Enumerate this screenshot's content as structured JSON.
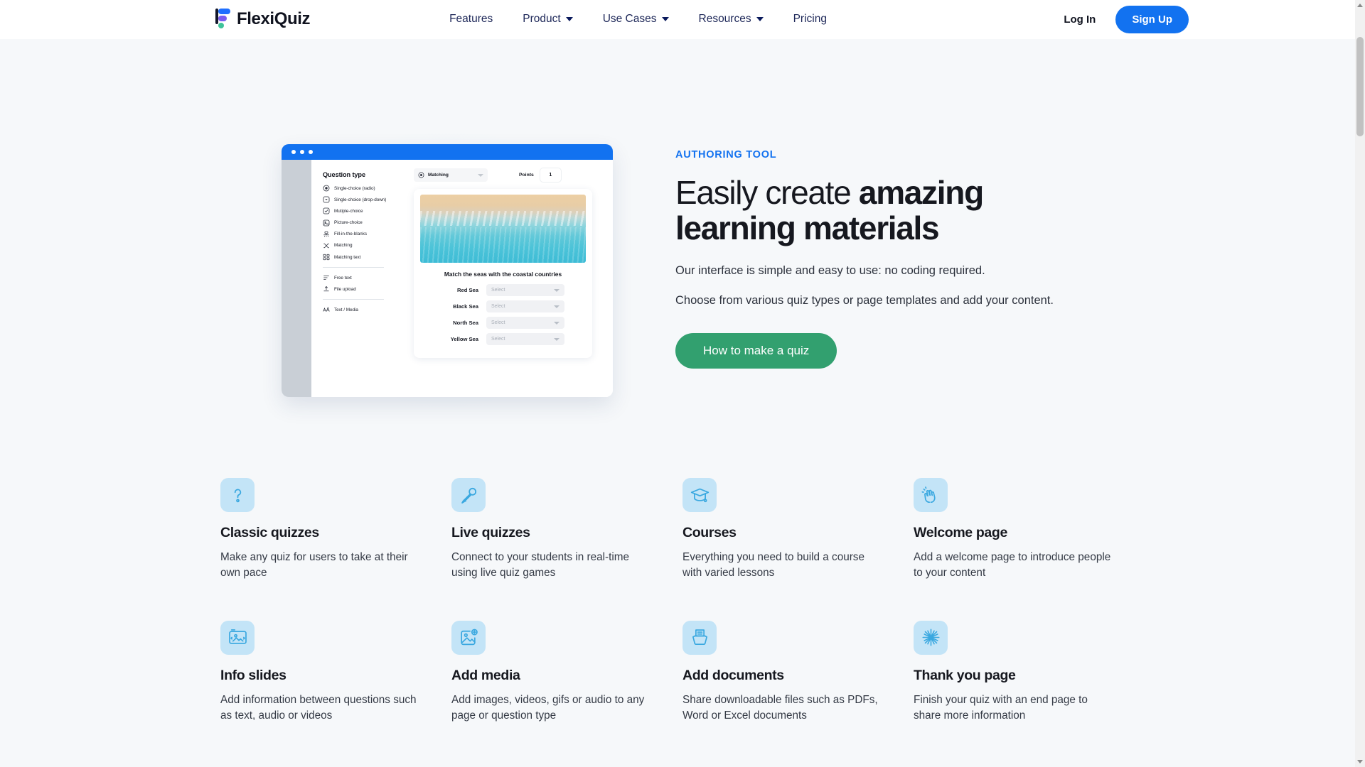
{
  "nav": {
    "logo_text": "FlexiQuiz",
    "links": [
      {
        "label": "Features",
        "has_caret": false
      },
      {
        "label": "Product",
        "has_caret": true
      },
      {
        "label": "Use Cases",
        "has_caret": true
      },
      {
        "label": "Resources",
        "has_caret": true
      },
      {
        "label": "Pricing",
        "has_caret": false
      }
    ],
    "login_label": "Log In",
    "signup_label": "Sign Up"
  },
  "hero": {
    "eyebrow": "AUTHORING TOOL",
    "heading_light": "Easily create ",
    "heading_bold_1": "amazing",
    "heading_bold_2": "learning materials",
    "paragraph_1": "Our interface is simple and easy to use: no coding required.",
    "paragraph_2": "Choose from various quiz types or page templates and add your content.",
    "cta_label": "How to make a quiz"
  },
  "mockup": {
    "question_type_title": "Question type",
    "question_types": [
      {
        "label": "Single-choice (radio)",
        "icon": "radio-icon"
      },
      {
        "label": "Single-choice (drop-down)",
        "icon": "dropdown-icon"
      },
      {
        "label": "Mutiple-choice",
        "icon": "checkbox-icon"
      },
      {
        "label": "Picture-choice",
        "icon": "picture-icon"
      },
      {
        "label": "Fill-in-the-blanks",
        "icon": "fill-blanks-icon"
      },
      {
        "label": "Matching",
        "icon": "shuffle-icon"
      },
      {
        "label": "Matching text",
        "icon": "matching-text-icon"
      }
    ],
    "extra_types": [
      {
        "label": "Free text",
        "icon": "free-text-icon"
      },
      {
        "label": "File upload",
        "icon": "upload-icon"
      }
    ],
    "media_types": [
      {
        "label": "Text / Media",
        "icon": "text-media-icon"
      }
    ],
    "selected_type": "Matching",
    "points_label": "Points",
    "points_value": "1",
    "question_prompt": "Match the seas with the coastal countries",
    "match_rows": [
      {
        "label": "Red Sea",
        "placeholder": "Select"
      },
      {
        "label": "Black Sea",
        "placeholder": "Select"
      },
      {
        "label": "North Sea",
        "placeholder": "Select"
      },
      {
        "label": "Yellow Sea",
        "placeholder": "Select"
      }
    ]
  },
  "features": [
    {
      "icon": "question-mark-icon",
      "title": "Classic quizzes",
      "desc": "Make any quiz for users to take at their own pace"
    },
    {
      "icon": "microphone-icon",
      "title": "Live quizzes",
      "desc": "Connect to your students in real-time using live quiz games"
    },
    {
      "icon": "graduation-cap-icon",
      "title": "Courses",
      "desc": "Everything you need to build a course with varied lessons"
    },
    {
      "icon": "waving-hand-icon",
      "title": "Welcome page",
      "desc": "Add a welcome page to introduce people to your content"
    },
    {
      "icon": "slideshow-image-icon",
      "title": "Info slides",
      "desc": "Add information between questions such as text, audio or videos"
    },
    {
      "icon": "add-image-icon",
      "title": "Add media",
      "desc": "Add images, videos, gifs or audio to any page or question type"
    },
    {
      "icon": "document-tray-icon",
      "title": "Add documents",
      "desc": "Share downloadable files such as PDFs, Word or Excel documents"
    },
    {
      "icon": "sparkle-burst-icon",
      "title": "Thank you page",
      "desc": "Finish your quiz with an end page to share more information"
    }
  ],
  "colors": {
    "brand_blue": "#1272f0",
    "cta_green": "#32a06f",
    "icon_blue": "#3aa8e0",
    "icon_bg": "#c3e4f7",
    "page_bg": "#f6f8fa",
    "heading": "#16181f"
  }
}
